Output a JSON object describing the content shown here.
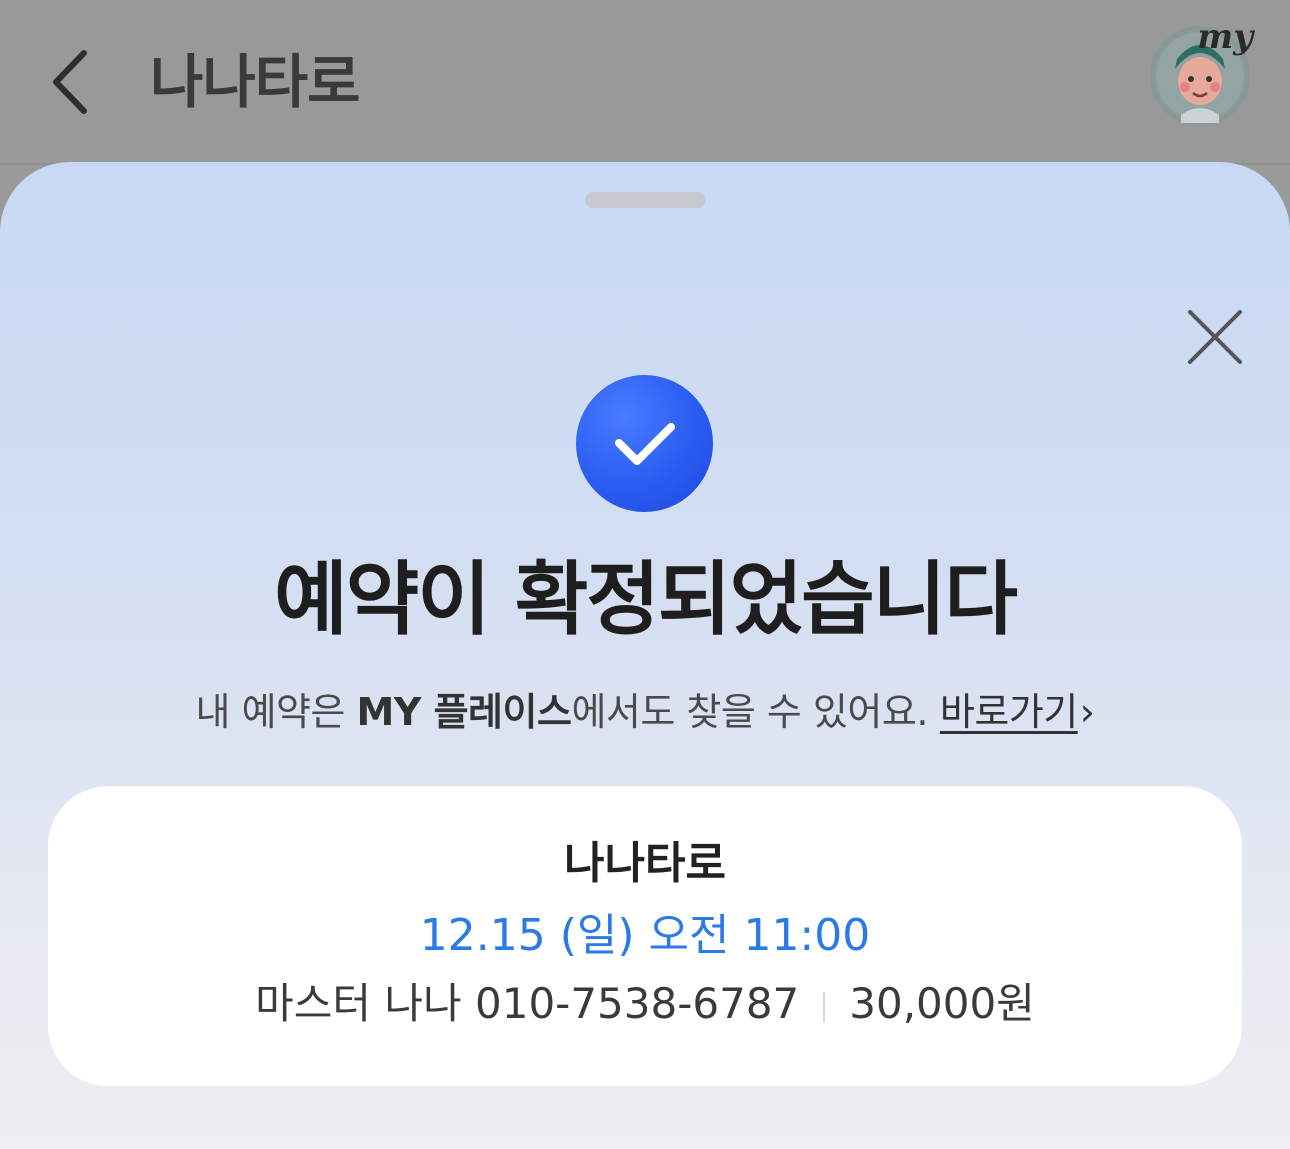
{
  "nav": {
    "title": "나나타로",
    "avatar_badge": "my"
  },
  "sheet": {
    "headline": "예약이 확정되었습니다",
    "subline_prefix": "내 예약은 ",
    "subline_bold": "MY 플레이스",
    "subline_suffix": "에서도 찾을 수 있어요.",
    "goto_label": "바로가기",
    "goto_chevron": "›"
  },
  "card": {
    "title": "나나타로",
    "datetime": "12.15 (일) 오전 11:00",
    "contact": "마스터 나나 010-7538-6787",
    "price": "30,000원"
  },
  "colors": {
    "accent_blue": "#2a7ae8",
    "check_badge": "#2a5cf2"
  },
  "icons": [
    "chevron-left-icon",
    "close-icon",
    "check-icon",
    "avatar"
  ]
}
